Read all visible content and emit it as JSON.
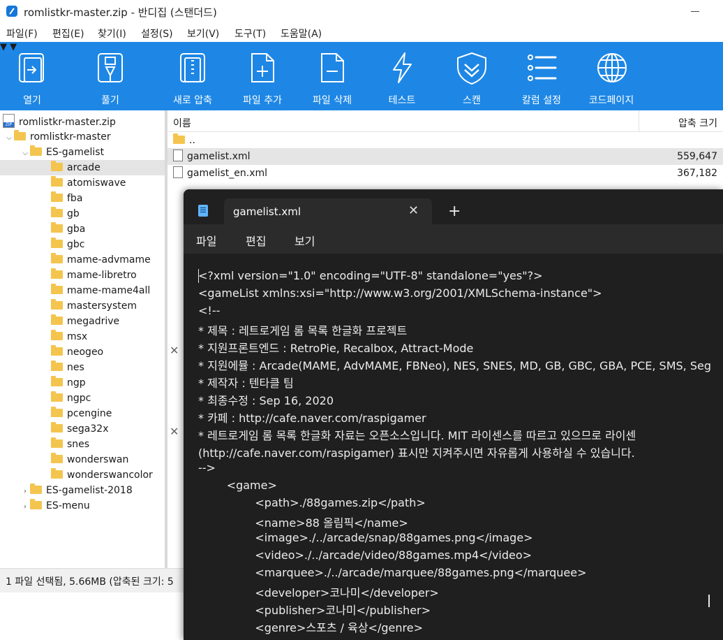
{
  "window": {
    "title": "romlistkr-master.zip - 반디집 (스탠더드)"
  },
  "menu": [
    "파일(F)",
    "편집(E)",
    "찾기(I)",
    "설정(S)",
    "보기(V)",
    "도구(T)",
    "도움말(A)"
  ],
  "toolbar": {
    "open": "열기",
    "extract": "풀기",
    "new_archive": "새로 압축",
    "add_file": "파일 추가",
    "delete_file": "파일 삭제",
    "test": "테스트",
    "scan": "스캔",
    "columns": "칼럼 설정",
    "codepage": "코드페이지"
  },
  "tree": {
    "root": "romlistkr-master.zip",
    "level1": "romlistkr-master",
    "es_gamelist": "ES-gamelist",
    "children": [
      "arcade",
      "atomiswave",
      "fba",
      "gb",
      "gba",
      "gbc",
      "mame-advmame",
      "mame-libretro",
      "mame-mame4all",
      "mastersystem",
      "megadrive",
      "msx",
      "neogeo",
      "nes",
      "ngp",
      "ngpc",
      "pcengine",
      "sega32x",
      "snes",
      "wonderswan",
      "wonderswancolor"
    ],
    "selected": "arcade",
    "es_gamelist_2018": "ES-gamelist-2018",
    "es_menu": "ES-menu"
  },
  "filelist": {
    "col_name": "이름",
    "col_size": "압축 크기",
    "parent": "..",
    "rows": [
      {
        "name": "gamelist.xml",
        "size": "559,647"
      },
      {
        "name": "gamelist_en.xml",
        "size": "367,182"
      }
    ]
  },
  "status": {
    "text": "1 파일 선택됨, 5.66MB (압축된 크기: 5"
  },
  "notepad": {
    "tab_title": "gamelist.xml",
    "menu": [
      "파일",
      "편집",
      "보기"
    ],
    "lines": [
      "<?xml version=\"1.0\" encoding=\"UTF-8\" standalone=\"yes\"?>",
      "<gameList xmlns:xsi=\"http://www.w3.org/2001/XMLSchema-instance\">",
      "<!--",
      "* 제목 : 레트로게임 롬 목록 한글화 프로젝트",
      "* 지원프론트엔드 : RetroPie, Recalbox, Attract-Mode",
      "* 지원에뮬 : Arcade(MAME, AdvMAME, FBNeo), NES, SNES, MD, GB, GBC, GBA, PCE, SMS, Seg",
      "* 제작자 : 텐타클 팀",
      "* 최종수정 : Sep 16, 2020",
      "* 카페 : http://cafe.naver.com/raspigamer",
      "* 레트로게임 롬 목록 한글화 자료는 오픈소스입니다. MIT 라이센스를 따르고 있으므로 라이센",
      "(http://cafe.naver.com/raspigamer) 표시만 지켜주시면 자유롭게 사용하실 수 있습니다.",
      "-->",
      "        <game>",
      "                <path>./88games.zip</path>",
      "                <name>88 올림픽</name>",
      "                <image>./../arcade/snap/88games.png</image>",
      "                <video>./../arcade/video/88games.mp4</video>",
      "                <marquee>./../arcade/marquee/88games.png</marquee>",
      "                <developer>코나미</developer>",
      "                <publisher>코나미</publisher>",
      "                <genre>스포츠 / 육상</genre>"
    ]
  },
  "colors": {
    "toolbar": "#1e87e5",
    "notepad_bg": "#1f1f1f",
    "selection": "#e4e4e4"
  }
}
